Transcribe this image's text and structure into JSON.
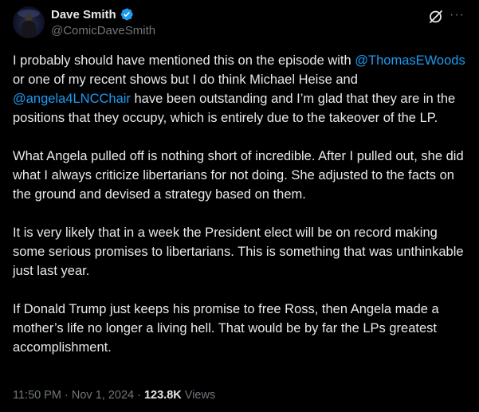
{
  "author": {
    "display_name": "Dave Smith",
    "handle": "@ComicDaveSmith",
    "verified_color": "#1d9bf0"
  },
  "actions": {
    "grok_icon": "grok-icon",
    "more_icon": "more-icon",
    "more_label": "···"
  },
  "tweet": {
    "p1_a": "I probably should have mentioned this on the episode with ",
    "p1_mention1": "@ThomasEWoods",
    "p1_b": " or one of my recent shows but I do think Michael Heise and ",
    "p1_mention2": "@angela4LNCChair",
    "p1_c": " have been outstanding and I’m glad that they are in the positions that they occupy, which is entirely due to the takeover of the LP.",
    "p2": "What Angela pulled off is nothing short of incredible. After I pulled out, she did what I always criticize libertarians for not doing. She adjusted to the facts on the ground and devised a strategy based on them.",
    "p3": "It is very likely that in a week the President elect will be on record making some serious promises to libertarians. This is something that was unthinkable just last year.",
    "p4": "If Donald Trump just keeps his promise to free Ross, then Angela made a mother’s life no longer a living hell. That would be by far the LPs greatest accomplishment."
  },
  "meta": {
    "time": "11:50 PM",
    "sep1": " · ",
    "date": "Nov 1, 2024",
    "sep2": " · ",
    "views_count": "123.8K",
    "views_label": " Views"
  },
  "colors": {
    "background": "#000000",
    "text": "#e7e9ea",
    "secondary": "#71767b",
    "link": "#1d9bf0"
  }
}
